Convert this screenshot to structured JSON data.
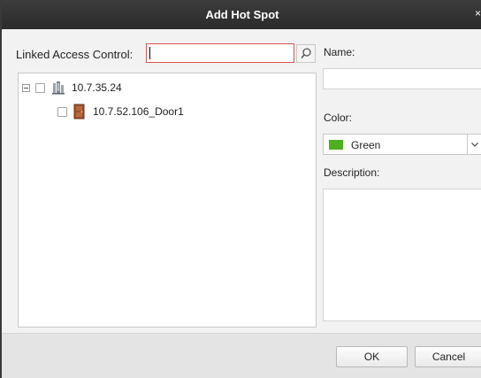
{
  "window": {
    "title": "Add Hot Spot",
    "close_glyph": "×"
  },
  "search": {
    "label": "Linked Access Control:",
    "value": "",
    "placeholder": "",
    "button_icon": "search-icon"
  },
  "tree": {
    "root": {
      "label": "10.7.35.24",
      "expanded": true,
      "checked": false,
      "icon": "access-controller-icon"
    },
    "children": [
      {
        "label": "10.7.52.106_Door1",
        "checked": false,
        "icon": "door-icon"
      }
    ]
  },
  "form": {
    "name_label": "Name:",
    "name_value": "",
    "color_label": "Color:",
    "color_value": "Green",
    "color_swatch": "#4caf1d",
    "description_label": "Description:",
    "description_value": ""
  },
  "buttons": {
    "ok": "OK",
    "cancel": "Cancel"
  },
  "colors": {
    "titlebar": "#333333",
    "search_border": "#d9534f",
    "footer": "#e4e4e4"
  }
}
